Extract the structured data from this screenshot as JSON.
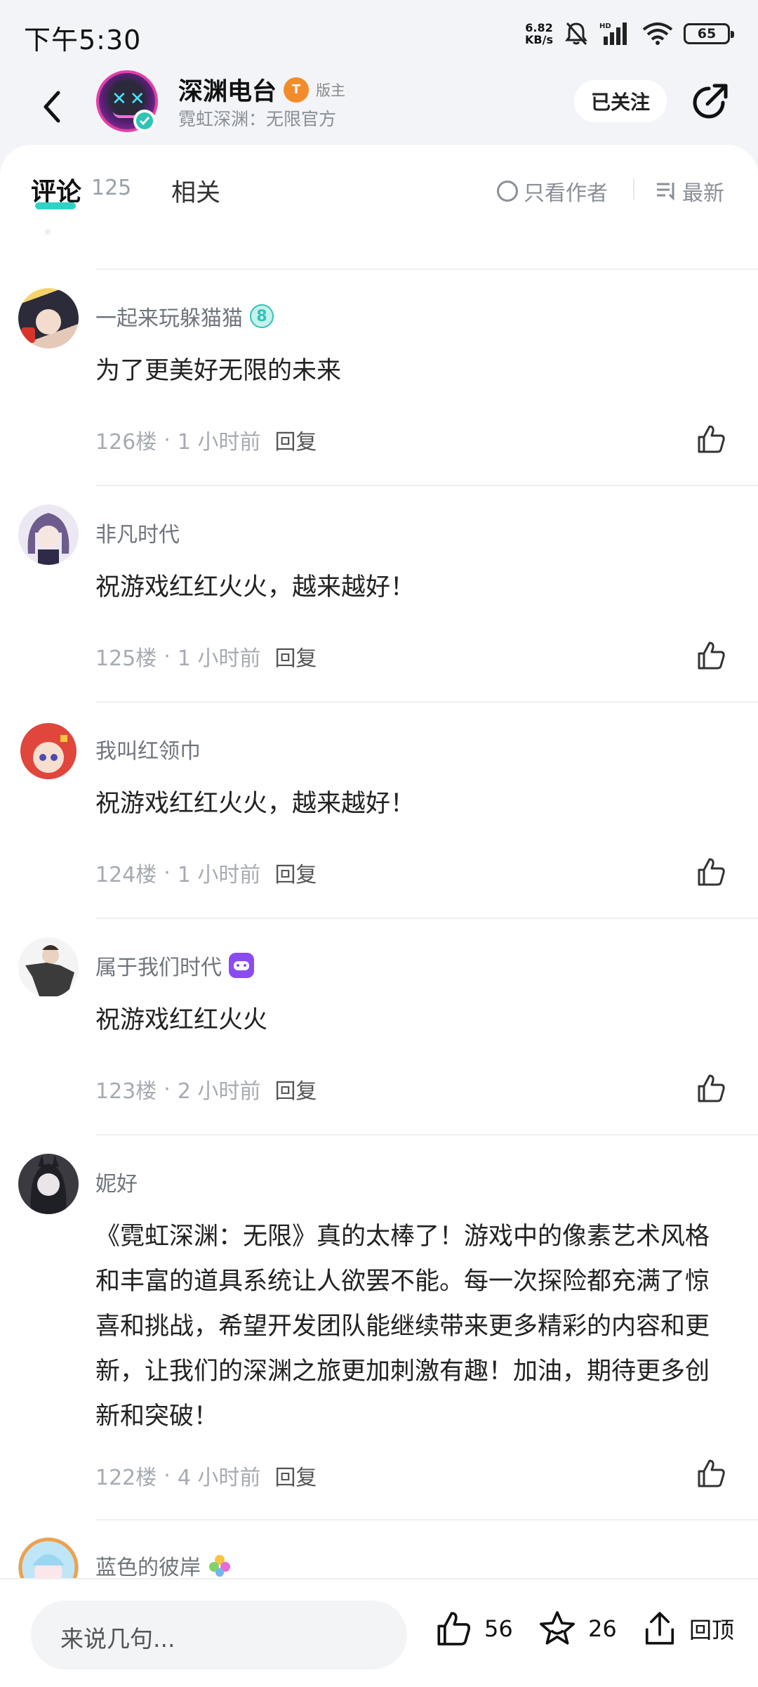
{
  "status_bar": {
    "time": "下午5:30",
    "net_speed_value": "6.82",
    "net_speed_unit": "KB/s",
    "battery": "65"
  },
  "header": {
    "name": "深渊电台",
    "level": "T",
    "role": "版主",
    "subtitle": "霓虹深渊：无限官方",
    "follow_label": "已关注"
  },
  "tabs": {
    "comments_label": "评论",
    "comments_count": "125",
    "related_label": "相关",
    "author_only_label": "只看作者",
    "sort_label": "最新"
  },
  "comments": [
    {
      "user": "一起来玩躲猫猫",
      "badge": "8",
      "text": "为了更美好无限的未来",
      "floor": "126楼",
      "time": "1 小时前",
      "reply": "回复"
    },
    {
      "user": "非凡时代",
      "text": "祝游戏红红火火，越来越好！",
      "floor": "125楼",
      "time": "1 小时前",
      "reply": "回复"
    },
    {
      "user": "我叫红领巾",
      "text": "祝游戏红红火火，越来越好！",
      "floor": "124楼",
      "time": "1 小时前",
      "reply": "回复"
    },
    {
      "user": "属于我们时代",
      "text": "祝游戏红红火火",
      "floor": "123楼",
      "time": "2 小时前",
      "reply": "回复"
    },
    {
      "user": "妮好",
      "text": "《霓虹深渊：无限》真的太棒了！游戏中的像素艺术风格和丰富的道具系统让人欲罢不能。每一次探险都充满了惊喜和挑战，希望开发团队能继续带来更多精彩的内容和更新，让我们的深渊之旅更加刺激有趣！加油，期待更多创新和突破！",
      "floor": "122楼",
      "time": "4 小时前",
      "reply": "回复"
    },
    {
      "user": "蓝色的彼岸"
    }
  ],
  "bottom_bar": {
    "input_placeholder": "来说几句...",
    "like_count": "56",
    "fav_count": "26",
    "top_label": "回顶"
  },
  "colors": {
    "accent": "#2ed3c5",
    "background": "#f2f4f7"
  }
}
